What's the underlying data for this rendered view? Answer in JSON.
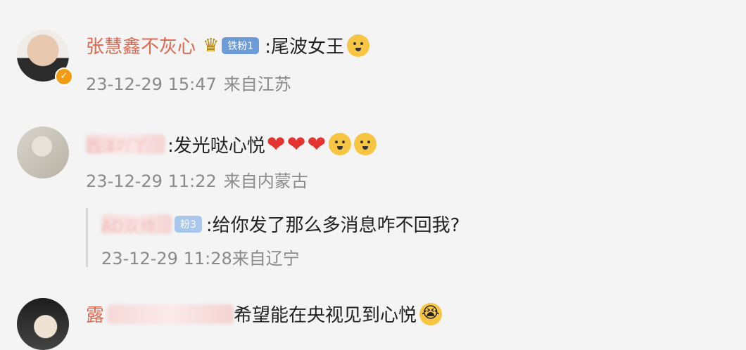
{
  "comments": [
    {
      "username": "张慧鑫不灰心",
      "fan_badge": "铁粉1",
      "text": ":尾波女王",
      "date": "23-12-29 15:47",
      "location": "来自江苏"
    },
    {
      "username_fragment": "西泽吖丫",
      "text": ":发光哒心悦",
      "date": "23-12-29 11:22",
      "location": "来自内蒙古",
      "reply": {
        "username_fragment": "AD双帅",
        "fan_badge": "粉3",
        "text": ":给你发了那么多消息咋不回我?",
        "date": "23-12-29 11:28",
        "location": "来自辽宁"
      }
    },
    {
      "username_fragment": "露",
      "text": "希望能在央视见到心悦"
    }
  ],
  "icons": {
    "verified": "verified-badge-icon",
    "crown": "crown-icon",
    "dog_emoji": "doge-emoji-icon",
    "heart": "heart-icon",
    "cry": "crying-emoji-icon"
  },
  "colors": {
    "username": "#e0684f",
    "meta": "#8a8a8a",
    "fan_badge": "#6b9bd8",
    "heart": "#e3342f"
  }
}
